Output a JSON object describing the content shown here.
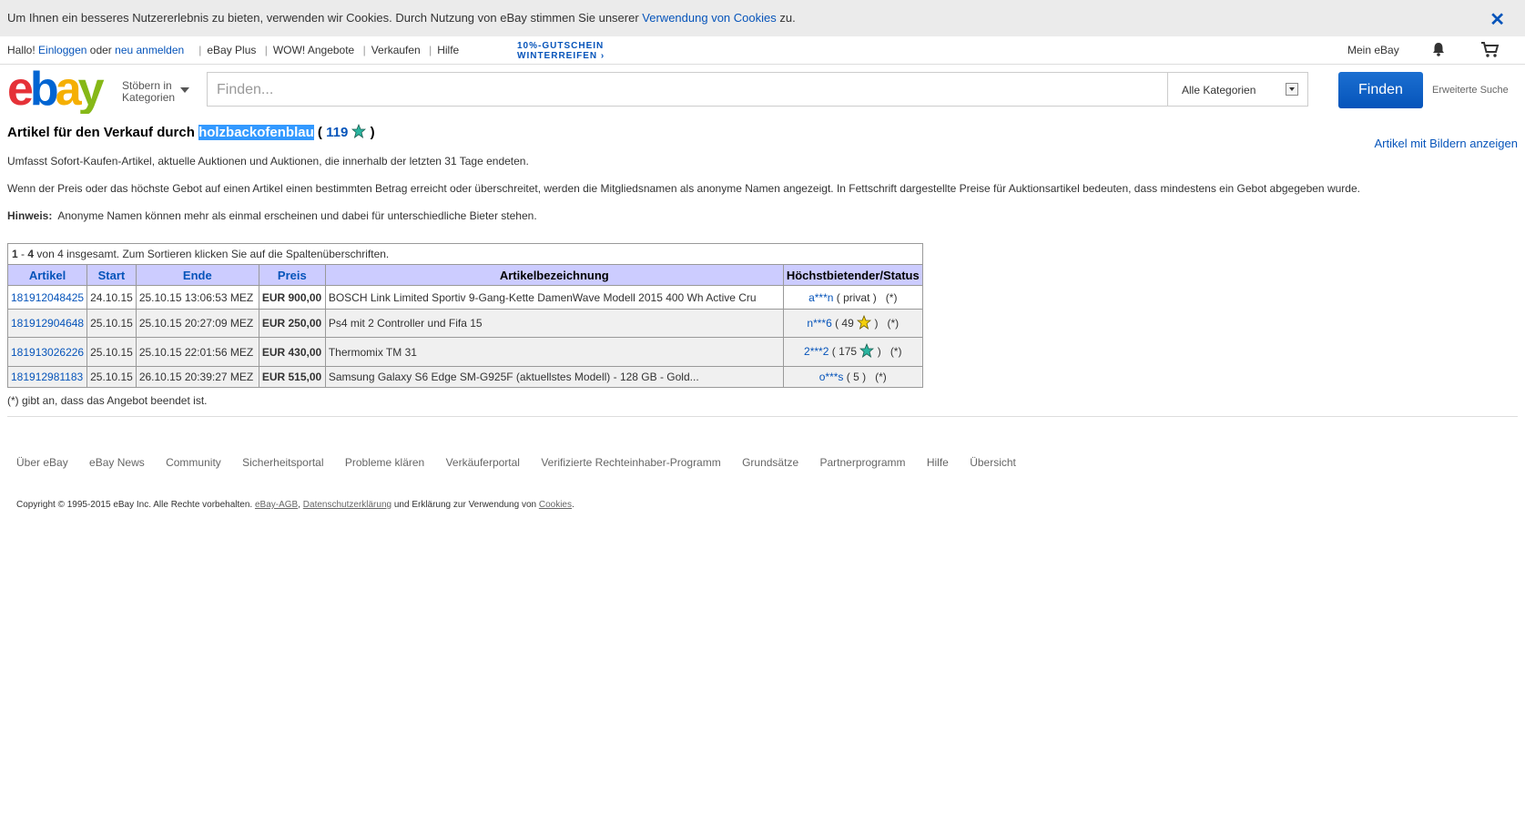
{
  "cookie_banner": {
    "text": "Um Ihnen ein besseres Nutzererlebnis zu bieten, verwenden wir Cookies. Durch Nutzung von eBay stimmen Sie unserer",
    "link": "Verwendung von Cookies",
    "suffix": "zu."
  },
  "topnav": {
    "greeting": "Hallo!",
    "login": "Einloggen",
    "or": "oder",
    "register": "neu anmelden",
    "items": [
      "eBay Plus",
      "WOW! Angebote",
      "Verkaufen",
      "Hilfe"
    ],
    "promo_line1": "10%-GUTSCHEIN",
    "promo_line2": "WINTERREIFEN ›",
    "my_ebay": "Mein eBay",
    "icons": [
      "bell-icon",
      "cart-icon"
    ]
  },
  "header": {
    "browse_line1": "Stöbern in",
    "browse_line2": "Kategorien",
    "search_placeholder": "Finden...",
    "category_selected": "Alle Kategorien",
    "find_button": "Finden",
    "advanced_search": "Erweiterte Suche"
  },
  "content": {
    "title_prefix": "Artikel für den Verkauf durch",
    "seller": "holzbackofenblau",
    "title_open": "(",
    "feedback_score": "119",
    "title_close": ")",
    "show_pictures": "Artikel mit Bildern anzeigen",
    "para1": "Umfasst Sofort-Kaufen-Artikel, aktuelle Auktionen und Auktionen, die innerhalb der letzten 31 Tage endeten.",
    "para2": "Wenn der Preis oder das höchste Gebot auf einen Artikel einen bestimmten Betrag erreicht oder überschreitet, werden die Mitgliedsnamen als anonyme Namen angezeigt. In Fettschrift dargestellte Preise für Auktionsartikel bedeuten, dass mindestens ein Gebot abgegeben wurde.",
    "hint_label": "Hinweis:",
    "hint_text": "Anonyme Namen können mehr als einmal erscheinen und dabei für unterschiedliche Bieter stehen."
  },
  "table": {
    "range_a": "1",
    "range_dash": " - ",
    "range_b": "4",
    "info_text": "von 4 insgesamt. Zum Sortieren klicken Sie auf die Spaltenüberschriften.",
    "headers": [
      "Artikel",
      "Start",
      "Ende",
      "Preis",
      "Artikelbezeichnung",
      "Höchstbietender/Status"
    ],
    "rows": [
      {
        "id": "181912048425",
        "start": "24.10.15",
        "end": "25.10.15 13:06:53 MEZ",
        "price": "EUR 900,00",
        "title": "BOSCH Link Limited Sportiv 9-Gang-Kette DamenWave Modell 2015 400 Wh Active Cru",
        "bidder": "a***n",
        "bidder_info": "( privat )",
        "status": "(*)",
        "star": ""
      },
      {
        "id": "181912904648",
        "start": "25.10.15",
        "end": "25.10.15 20:27:09 MEZ",
        "price": "EUR 250,00",
        "title": "Ps4 mit 2 Controller und Fifa 15",
        "bidder": "n***6",
        "bidder_info": "( 49",
        "bidder_close": ")",
        "status": "(*)",
        "star": "yellow"
      },
      {
        "id": "181913026226",
        "start": "25.10.15",
        "end": "25.10.15 22:01:56 MEZ",
        "price": "EUR 430,00",
        "title": "Thermomix TM 31",
        "bidder": "2***2",
        "bidder_info": "( 175",
        "bidder_close": ")",
        "status": "(*)",
        "star": "teal"
      },
      {
        "id": "181912981183",
        "start": "25.10.15",
        "end": "26.10.15 20:39:27 MEZ",
        "price": "EUR 515,00",
        "title": "Samsung Galaxy S6 Edge SM-G925F (aktuellstes Modell) - 128 GB - Gold...",
        "bidder": "o***s",
        "bidder_info": "( 5 )",
        "status": "(*)",
        "star": ""
      }
    ],
    "footnote": "(*) gibt an, dass das Angebot beendet ist."
  },
  "footer": {
    "links": [
      "Über eBay",
      "eBay News",
      "Community",
      "Sicherheitsportal",
      "Probleme klären",
      "Verkäuferportal",
      "Verifizierte Rechteinhaber-Programm",
      "Grundsätze",
      "Partnerprogramm",
      "Hilfe",
      "Übersicht"
    ],
    "copyright_prefix": "Copyright © 1995-2015 eBay Inc. Alle Rechte vorbehalten.",
    "agb": "eBay-AGB",
    "comma": ",",
    "privacy": "Datenschutzerklärung",
    "and_text": "und Erklärung zur Verwendung von",
    "cookies": "Cookies",
    "period": "."
  },
  "colors": {
    "link_blue": "#0654ba",
    "header_lavender": "#ccccff",
    "star_teal": "#2bb5a0",
    "star_yellow": "#f5d00a"
  }
}
